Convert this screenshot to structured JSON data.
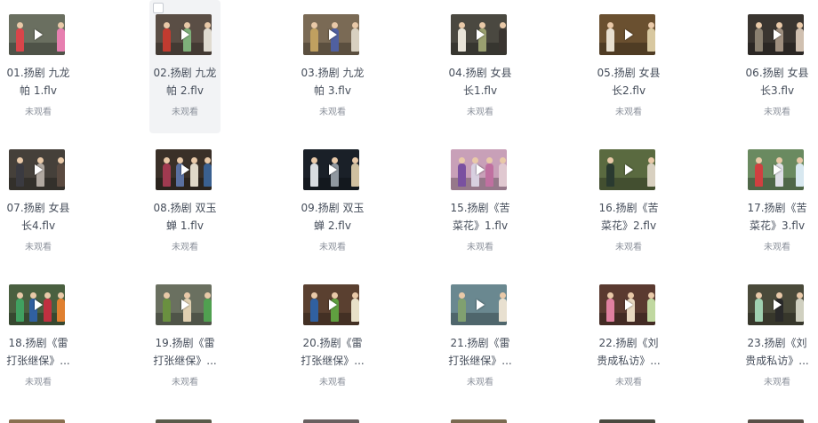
{
  "items": [
    {
      "title_lines": [
        "01.扬剧 九龙",
        "帕 1.flv"
      ],
      "status": "未观看",
      "bg": "#6a6f60",
      "figs": [
        "#d9454a",
        "#e77fb0"
      ]
    },
    {
      "title_lines": [
        "02.扬剧 九龙",
        "帕 2.flv"
      ],
      "status": "未观看",
      "bg": "#5a4e45",
      "figs": [
        "#c23b30",
        "#7fb07a",
        "#e0dbd0"
      ]
    },
    {
      "title_lines": [
        "03.扬剧 九龙",
        "帕 3.flv"
      ],
      "status": "未观看",
      "bg": "#7a6a55",
      "figs": [
        "#c0a060",
        "#5060a0",
        "#d8d0c0"
      ]
    },
    {
      "title_lines": [
        "04.扬剧 女县",
        "长1.flv"
      ],
      "status": "未观看",
      "bg": "#4a4840",
      "figs": [
        "#e8e4d8",
        "#9aa070",
        "#3a3530"
      ]
    },
    {
      "title_lines": [
        "05.扬剧 女县",
        "长2.flv"
      ],
      "status": "未观看",
      "bg": "#6a5030",
      "figs": [
        "#e8e0d0",
        "#d8c8a0"
      ]
    },
    {
      "title_lines": [
        "06.扬剧 女县",
        "长3.flv"
      ],
      "status": "未观看",
      "bg": "#3a3530",
      "figs": [
        "#8a8070",
        "#a09080",
        "#d0c0b0"
      ]
    },
    {
      "title_lines": [
        "07.扬剧 女县",
        "长4.flv"
      ],
      "status": "未观看",
      "bg": "#45403a",
      "figs": [
        "#3a3a40",
        "#b0a8a0",
        "#5a4a40"
      ]
    },
    {
      "title_lines": [
        "08.扬剧 双玉",
        "蝉 1.flv"
      ],
      "status": "未观看",
      "bg": "#3a3028",
      "figs": [
        "#a03a50",
        "#5a70a0",
        "#e0d8c8",
        "#3a6090"
      ]
    },
    {
      "title_lines": [
        "09.扬剧 双玉",
        "蝉 2.flv"
      ],
      "status": "未观看",
      "bg": "#1a2028",
      "figs": [
        "#d8dce0",
        "#9098a0",
        "#d0c0a0"
      ]
    },
    {
      "title_lines": [
        "15.扬剧《苦",
        "菜花》1.flv"
      ],
      "status": "未观看",
      "bg": "#c8a0b8",
      "figs": [
        "#7a50a0",
        "#d8d0e0",
        "#c070a0",
        "#e0c8d0"
      ]
    },
    {
      "title_lines": [
        "16.扬剧《苦",
        "菜花》2.flv"
      ],
      "status": "未观看",
      "bg": "#5a6a40",
      "figs": [
        "#2a3a30",
        "#d8d0c0"
      ]
    },
    {
      "title_lines": [
        "17.扬剧《苦",
        "菜花》3.flv"
      ],
      "status": "未观看",
      "bg": "#6a8a60",
      "figs": [
        "#d04040",
        "#e0e0e8",
        "#d8e8f0"
      ]
    },
    {
      "title_lines": [
        "18.扬剧《雷",
        "打张继保》..."
      ],
      "status": "未观看",
      "bg": "#4a6040",
      "figs": [
        "#40a060",
        "#3060a0",
        "#c03040",
        "#e08030"
      ]
    },
    {
      "title_lines": [
        "19.扬剧《雷",
        "打张继保》..."
      ],
      "status": "未观看",
      "bg": "#6a7060",
      "figs": [
        "#6a9040",
        "#e0d0b0",
        "#50a050"
      ]
    },
    {
      "title_lines": [
        "20.扬剧《雷",
        "打张继保》..."
      ],
      "status": "未观看",
      "bg": "#5a4030",
      "figs": [
        "#3060a0",
        "#60a040",
        "#e8e0c8"
      ]
    },
    {
      "title_lines": [
        "21.扬剧《雷",
        "打张继保》..."
      ],
      "status": "未观看",
      "bg": "#6a8890",
      "figs": [
        "#80a070",
        "#e8e0d0"
      ]
    },
    {
      "title_lines": [
        "22.扬剧《刘",
        "贵成私访》..."
      ],
      "status": "未观看",
      "bg": "#5a3a30",
      "figs": [
        "#e080a0",
        "#e8d8c0",
        "#c0d8a0"
      ]
    },
    {
      "title_lines": [
        "23.扬剧《刘",
        "贵成私访》..."
      ],
      "status": "未观看",
      "bg": "#4a4a3a",
      "figs": [
        "#a0d0b0",
        "#2a2a2a",
        "#d0d0c0"
      ]
    }
  ]
}
